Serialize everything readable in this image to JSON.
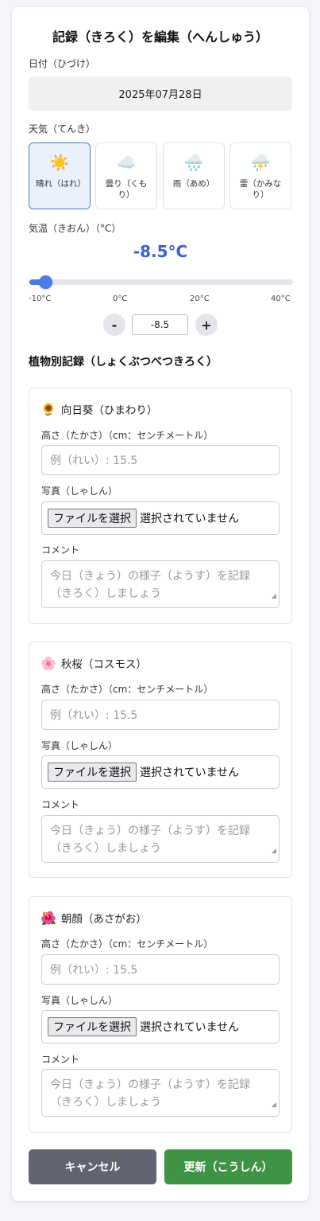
{
  "header": {
    "title": "記録（きろく）を編集（へんしゅう）"
  },
  "date": {
    "label": "日付（ひづけ）",
    "value": "2025年07月28日"
  },
  "weather": {
    "label": "天気（てんき）",
    "selected": "sunny",
    "options": [
      {
        "label": "晴れ（はれ）",
        "icon": "sun-icon",
        "glyph": "☀️"
      },
      {
        "label": "曇り（くもり）",
        "icon": "cloud-icon",
        "glyph": "☁️"
      },
      {
        "label": "雨（あめ）",
        "icon": "rain-icon",
        "glyph": "🌧️"
      },
      {
        "label": "雷（かみなり）",
        "icon": "thunder-icon",
        "glyph": "⛈️"
      }
    ]
  },
  "temperature": {
    "label": "気温（きおん）（°C）",
    "display": "-8.5°C",
    "value": -8.5,
    "min": -10,
    "max": 40,
    "ticks": [
      "-10°C",
      "0°C",
      "20°C",
      "40°C"
    ],
    "input_value": "-8.5",
    "minus_label": "-",
    "plus_label": "+"
  },
  "plants_section": {
    "title": "植物別記録（しょくぶつべつきろく）",
    "height_label": "高さ（たかさ）（cm：センチメートル）",
    "height_placeholder": "例（れい）: 15.5",
    "photo_label": "写真（しゃしん）",
    "file_button": "ファイルを選択",
    "file_status": "選択されていません",
    "comment_label": "コメント",
    "comment_placeholder": "今日（きょう）の様子（ようす）を記録（きろく）しましょう",
    "plants": [
      {
        "name": "向日葵（ひまわり）",
        "icon": "sunflower-icon",
        "glyph": "🌻"
      },
      {
        "name": "秋桜（コスモス）",
        "icon": "cosmos-icon",
        "glyph": "🌸"
      },
      {
        "name": "朝顔（あさがお）",
        "icon": "morning-glory-icon",
        "glyph": "🌺"
      }
    ]
  },
  "actions": {
    "cancel": "キャンセル",
    "update": "更新（こうしん）"
  },
  "colors": {
    "accent": "#4a7be6",
    "temp_text": "#3b5fd6",
    "cancel_bg": "#5f6470",
    "update_bg": "#3e9444"
  }
}
